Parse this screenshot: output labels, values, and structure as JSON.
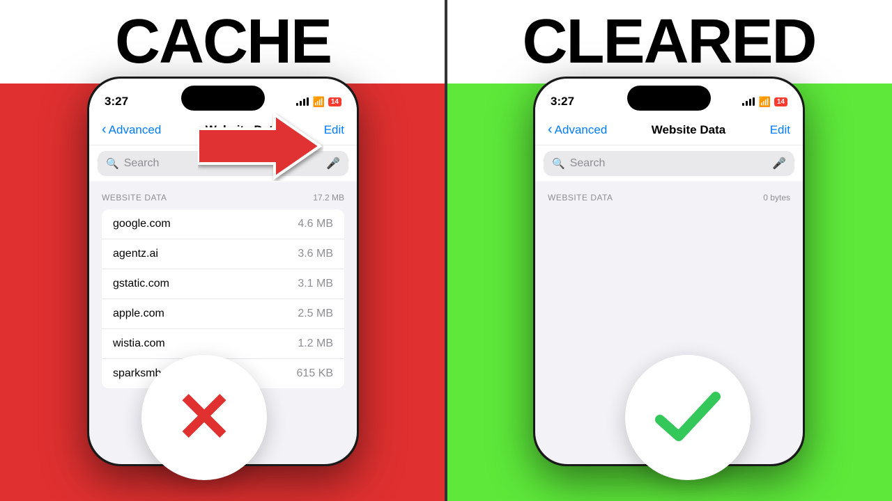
{
  "left_panel": {
    "background": "#e03030",
    "title": "CACHE",
    "phone": {
      "time": "3:27",
      "nav": {
        "back_label": "Advanced",
        "title": "Website Data",
        "edit_label": "Edit"
      },
      "search_placeholder": "Search",
      "section": {
        "label": "WEBSITE DATA",
        "total": "17.2 MB"
      },
      "items": [
        {
          "domain": "google.com",
          "size": "4.6 MB"
        },
        {
          "domain": "agentz.ai",
          "size": "3.6 MB"
        },
        {
          "domain": "gstatic.com",
          "size": "3.1 MB"
        },
        {
          "domain": "apple.com",
          "size": "2.5 MB"
        },
        {
          "domain": "wistia.com",
          "size": "1.2 MB"
        },
        {
          "domain": "sparksmb.com",
          "size": "615 KB"
        }
      ]
    }
  },
  "right_panel": {
    "background": "#5de83a",
    "title": "CLEARED",
    "phone": {
      "time": "3:27",
      "nav": {
        "back_label": "Advanced",
        "title": "Website Data",
        "edit_label": "Edit"
      },
      "search_placeholder": "Search",
      "section": {
        "label": "WEBSITE DATA",
        "total": "0 bytes"
      },
      "items": []
    }
  },
  "icons": {
    "search": "🔍",
    "mic": "🎤",
    "chevron_left": "‹",
    "x_mark": "✕",
    "check_mark": "✓"
  }
}
